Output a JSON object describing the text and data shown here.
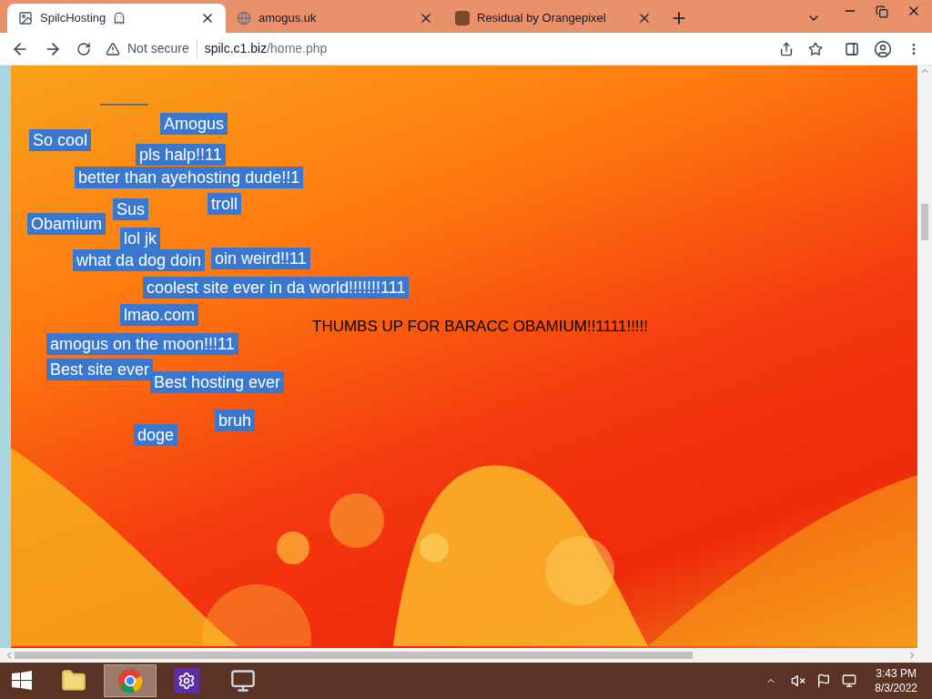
{
  "browser": {
    "tabs": [
      {
        "title": "SpilcHosting",
        "selected": true
      },
      {
        "title": "amogus.uk",
        "selected": false
      },
      {
        "title": "Residual by Orangepixel",
        "selected": false
      }
    ],
    "security": "Not secure",
    "url_host": "spilc.c1.biz",
    "url_path": "/home.php"
  },
  "page": {
    "labels": [
      {
        "text": "Amogus",
        "kind": "chip"
      },
      {
        "text": "So cool",
        "kind": "chip"
      },
      {
        "text": "pls halp!!11",
        "kind": "chip"
      },
      {
        "text": "better than ayehosting dude!!1",
        "kind": "chip"
      },
      {
        "text": "troll",
        "kind": "chip"
      },
      {
        "text": "Sus",
        "kind": "chip"
      },
      {
        "text": "Obamium",
        "kind": "chip"
      },
      {
        "text": "lol jk",
        "kind": "chip"
      },
      {
        "text": "what da dog doin",
        "kind": "chip"
      },
      {
        "text": "oin weird!!11",
        "kind": "chip"
      },
      {
        "text": "coolest site ever in da world!!!!!!!111",
        "kind": "chip"
      },
      {
        "text": "lmao.com",
        "kind": "chip"
      },
      {
        "text": "THUMBS UP FOR BARACC OBAMIUM!!1111!!!!!",
        "kind": "plain"
      },
      {
        "text": "amogus on the moon!!!11",
        "kind": "chip"
      },
      {
        "text": "Best site ever",
        "kind": "chip"
      },
      {
        "text": "Best hosting ever",
        "kind": "chip"
      },
      {
        "text": "bruh",
        "kind": "chip"
      },
      {
        "text": "doge",
        "kind": "chip"
      }
    ]
  },
  "taskbar": {
    "apps": [
      {
        "kind": "folder",
        "selected": false
      },
      {
        "kind": "chrome",
        "selected": true
      },
      {
        "kind": "settings",
        "selected": false
      },
      {
        "kind": "monitor",
        "selected": false
      }
    ],
    "time": "3:43 PM",
    "date": "8/3/2022"
  }
}
